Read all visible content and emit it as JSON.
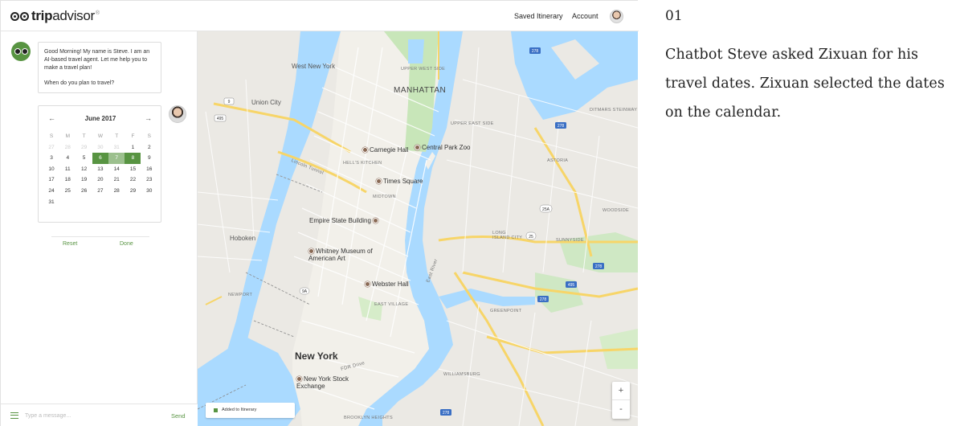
{
  "brand": {
    "logo_text_bold": "trip",
    "logo_text_regular": "advisor",
    "logo_mark": "owl-eyes-icon",
    "accent": "#589442"
  },
  "header": {
    "saved_itinerary": "Saved Itinerary",
    "account": "Account"
  },
  "chat": {
    "bot_message": [
      "Good Morning! My name is Steve. I am an AI-based travel agent. Let me help you to make a travel plan!",
      "When do you plan to travel?"
    ],
    "input_placeholder": "Type a message...",
    "send_label": "Send"
  },
  "calendar": {
    "title": "June 2017",
    "prev_icon": "←",
    "next_icon": "→",
    "weekdays": [
      "S",
      "M",
      "T",
      "W",
      "T",
      "F",
      "S"
    ],
    "days": [
      {
        "d": "27",
        "s": "muted"
      },
      {
        "d": "28",
        "s": "muted"
      },
      {
        "d": "29",
        "s": "muted"
      },
      {
        "d": "30",
        "s": "muted"
      },
      {
        "d": "31",
        "s": "muted"
      },
      {
        "d": "1",
        "s": ""
      },
      {
        "d": "2",
        "s": ""
      },
      {
        "d": "3",
        "s": ""
      },
      {
        "d": "4",
        "s": ""
      },
      {
        "d": "5",
        "s": ""
      },
      {
        "d": "6",
        "s": "sel"
      },
      {
        "d": "7",
        "s": "range"
      },
      {
        "d": "8",
        "s": "sel"
      },
      {
        "d": "9",
        "s": ""
      },
      {
        "d": "10",
        "s": ""
      },
      {
        "d": "11",
        "s": ""
      },
      {
        "d": "12",
        "s": ""
      },
      {
        "d": "13",
        "s": ""
      },
      {
        "d": "14",
        "s": ""
      },
      {
        "d": "15",
        "s": ""
      },
      {
        "d": "16",
        "s": ""
      },
      {
        "d": "17",
        "s": ""
      },
      {
        "d": "18",
        "s": ""
      },
      {
        "d": "19",
        "s": ""
      },
      {
        "d": "20",
        "s": ""
      },
      {
        "d": "21",
        "s": ""
      },
      {
        "d": "22",
        "s": ""
      },
      {
        "d": "23",
        "s": ""
      },
      {
        "d": "24",
        "s": ""
      },
      {
        "d": "25",
        "s": ""
      },
      {
        "d": "26",
        "s": ""
      },
      {
        "d": "27",
        "s": ""
      },
      {
        "d": "28",
        "s": ""
      },
      {
        "d": "29",
        "s": ""
      },
      {
        "d": "30",
        "s": ""
      },
      {
        "d": "31",
        "s": ""
      }
    ],
    "reset_label": "Reset",
    "done_label": "Done"
  },
  "map": {
    "labels": {
      "west_new_york": "West New York",
      "union_city": "Union City",
      "hoboken": "Hoboken",
      "manhattan": "MANHATTAN",
      "new_york": "New York",
      "upper_west_side": "UPPER WEST SIDE",
      "upper_east_side": "UPPER EAST SIDE",
      "hells_kitchen": "HELL'S KITCHEN",
      "midtown": "MIDTOWN",
      "east_village": "EAST VILLAGE",
      "newport": "NEWPORT",
      "astoria": "ASTORIA",
      "ditmars": "DITMARS STEINWAY",
      "woodside": "WOODSIDE",
      "sunnyside": "SUNNYSIDE",
      "long_island_city": "LONG ISLAND CITY",
      "greenpoint": "GREENPOINT",
      "williamsburg": "WILLIAMSBURG",
      "brooklyn_heights": "BROOKLYN HEIGHTS",
      "east_river": "East River",
      "lincoln_tunnel": "Lincoln Tunnel",
      "fdr_drive": "FDR Drive"
    },
    "pois": {
      "carnegie_hall": "Carnegie Hall",
      "central_park_zoo": "Central Park Zoo",
      "times_square": "Times Square",
      "empire_state": "Empire State Building",
      "whitney": "Whitney Museum of American Art",
      "webster_hall": "Webster Hall",
      "nyse": "New York Stock Exchange"
    },
    "shields": [
      "9",
      "495",
      "278",
      "278",
      "25A",
      "25",
      "278",
      "495",
      "278",
      "9A",
      "278"
    ],
    "zoom_in": "+",
    "zoom_out": "-",
    "toast": "Added to Itinerary"
  },
  "caption": {
    "number": "01",
    "text": "Chatbot Steve asked Zixuan for his travel dates. Zixuan selected the dates on the calendar."
  }
}
